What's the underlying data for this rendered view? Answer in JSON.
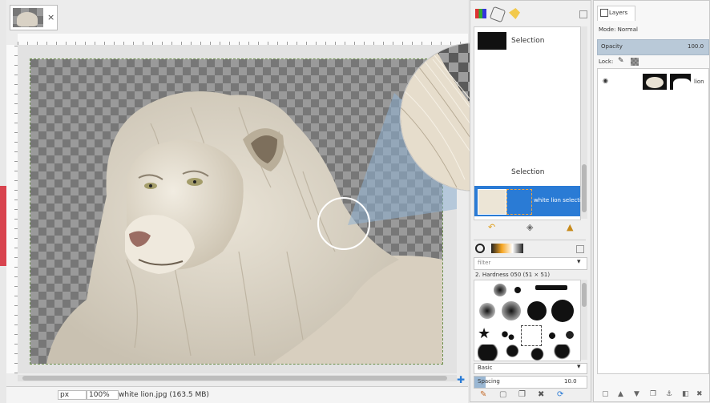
{
  "image_window": {
    "tab_close": "×",
    "status": {
      "unit": "px",
      "zoom": "100%",
      "info": "white lion.jpg (163.5 MB)"
    }
  },
  "layers_tab": {
    "label": "Layers",
    "mode_label": "Mode: Normal",
    "opacity_label": "Opacity",
    "opacity_value": "100.0",
    "lock_label": "Lock:",
    "layer_name": "lion"
  },
  "middle_dock": {
    "paths": {
      "item_top": "Selection",
      "item_mid": "Selection",
      "item_selected": "white lion selection"
    },
    "brushes": {
      "filter_value": "filter",
      "category_label": "2. Hardness 050 (51 × 51)",
      "tag_label": "Basic",
      "spacing_label": "Spacing",
      "spacing_value": "10.0"
    }
  },
  "colors": {
    "accent_selected": "#2a7bd5",
    "banner_red": "#d8434e"
  }
}
